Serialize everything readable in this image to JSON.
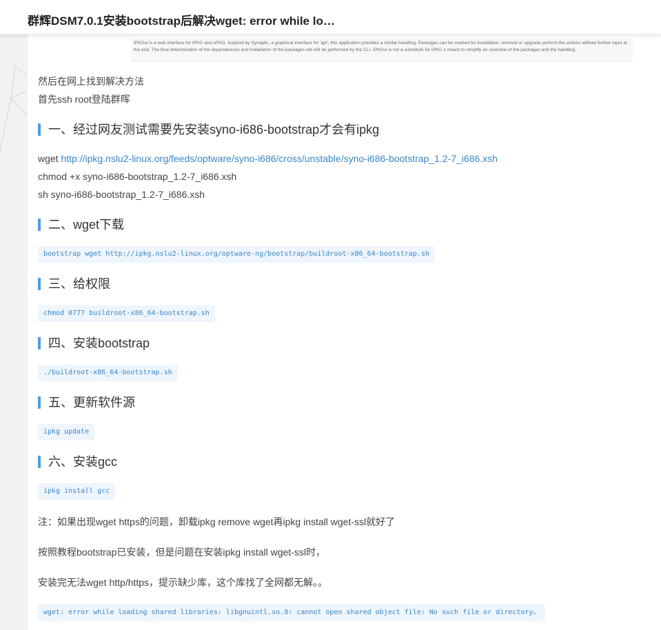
{
  "header": {
    "title": "群辉DSM7.0.1安装bootstrap后解决wget: error while lo…"
  },
  "screenshot": {
    "text": "iPKGui is a web interface for iPKG and oPKG. Inspired by Synaptic, a graphical interface for 'apt', this application provides a similar handling. Packages can be marked for installation, removal or upgrade perform the actions without further input at the end. The final determination of the dependencies and installation of the packages will still be performed by the CLI. iPKGui is not a substitute for iPKG o meant to simplify an overview of the packages and the handling."
  },
  "intro": [
    "然后在网上找到解决方法",
    "首先ssh root登陆群晖"
  ],
  "sections": [
    {
      "heading": "一、经过网友测试需要先安装syno-i686-bootstrap才会有ipkg",
      "wget_prefix": "wget ",
      "link": "http://ipkg.nslu2-linux.org/feeds/optware/syno-i686/cross/unstable/syno-i686-bootstrap_1.2-7_i686.xsh",
      "lines": [
        "chmod +x syno-i686-bootstrap_1.2-7_i686.xsh",
        "sh syno-i686-bootstrap_1.2-7_i686.xsh"
      ]
    },
    {
      "heading": "二、wget下载",
      "code": "bootstrap wget http://ipkg.nslu2-linux.org/optware-ng/bootstrap/buildroot-x86_64-bootstrap.sh"
    },
    {
      "heading": "三、给权限",
      "code": "chmod 0777 buildroot-x86_64-bootstrap.sh"
    },
    {
      "heading": "四、安装bootstrap",
      "code": "./buildroot-x86_64-bootstrap.sh"
    },
    {
      "heading": "五、更新软件源",
      "code": "ipkg update"
    },
    {
      "heading": "六、安装gcc",
      "code": "ipkg install gcc"
    }
  ],
  "notes": [
    "注：如果出现wget https的问题，卸载ipkg remove wget再ipkg install wget-ssl就好了",
    "按照教程bootstrap已安装，但是问题在安装ipkg install wget-ssl时，",
    "安装完无法wget http/https，提示缺少库，这个库找了全网都无解。。"
  ],
  "error_code": "wget: error while loading shared libraries: libgnuintl.so.8: cannot open shared object file: No such file or directory。",
  "colors": {
    "accent": "#4a9be8",
    "link": "#3a86c8",
    "code_bg": "#eef5fd",
    "page_bg": "#f2f2f2"
  }
}
